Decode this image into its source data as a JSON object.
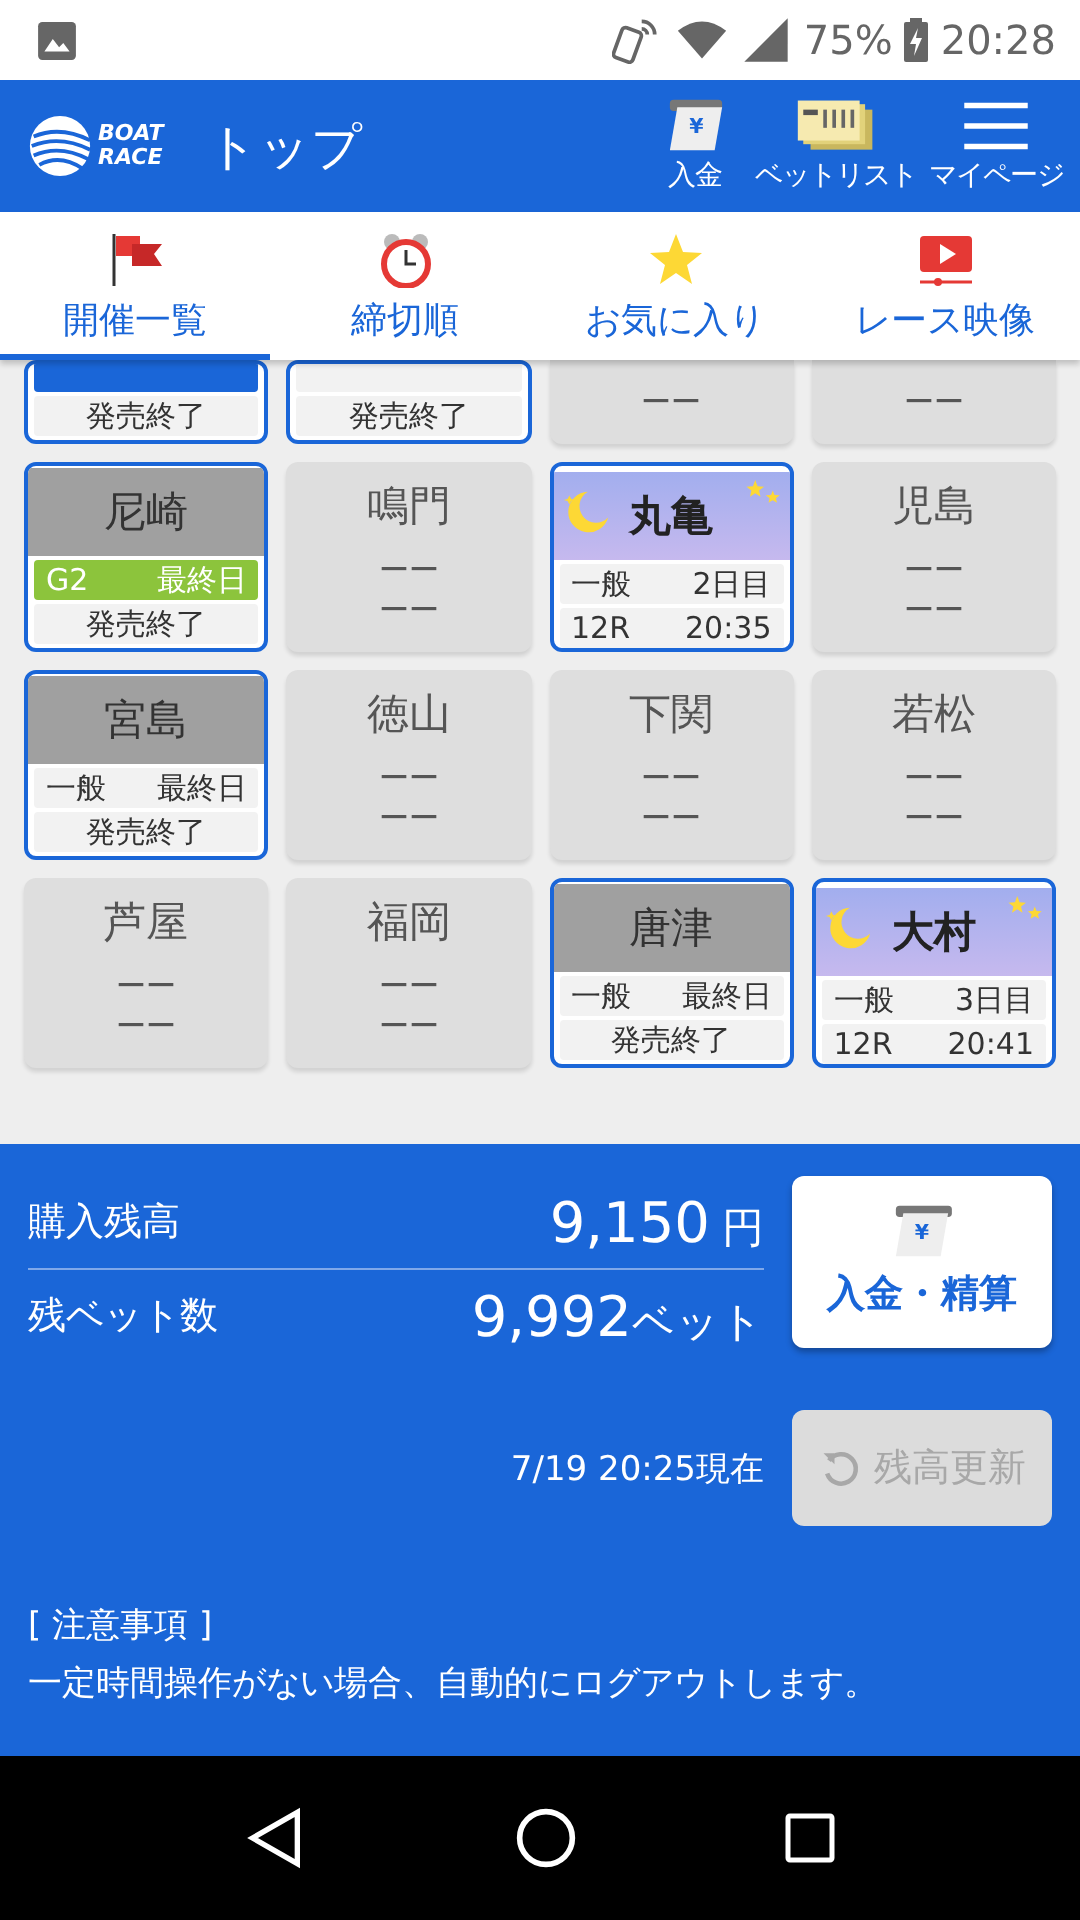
{
  "status_bar": {
    "battery": "75%",
    "time": "20:28"
  },
  "header": {
    "logo": [
      "BOAT",
      "RACE"
    ],
    "title": "トップ",
    "yen_mark": "¥",
    "actions": [
      "入金",
      "ベットリスト",
      "マイページ"
    ]
  },
  "tabs": [
    {
      "label": "開催一覧",
      "selected": true
    },
    {
      "label": "締切順",
      "selected": false
    },
    {
      "label": "お気に入り",
      "selected": false
    },
    {
      "label": "レース映像",
      "selected": false
    }
  ],
  "venues": [
    {
      "kind": "closed",
      "status": "発売終了",
      "color": "#1a66d8"
    },
    {
      "kind": "closed",
      "status": "発売終了"
    },
    {
      "kind": "inactive",
      "line_2": "ーー"
    },
    {
      "kind": "inactive",
      "line_2": "ーー"
    },
    {
      "kind": "closed",
      "name": "尼崎",
      "grade": "G2",
      "day": "最終日",
      "status": "発売終了",
      "color": "#8cc43c"
    },
    {
      "kind": "inactive",
      "name": "鳴門",
      "line_1": "ーー",
      "line_2": "ーー"
    },
    {
      "kind": "night",
      "name": "丸亀",
      "grade": "一般",
      "day": "2日目",
      "race": "12R",
      "time": "20:35"
    },
    {
      "kind": "inactive",
      "name": "児島",
      "line_1": "ーー",
      "line_2": "ーー"
    },
    {
      "kind": "closed",
      "name": "宮島",
      "grade": "一般",
      "day": "最終日",
      "status": "発売終了"
    },
    {
      "kind": "inactive",
      "name": "徳山",
      "line_1": "ーー",
      "line_2": "ーー"
    },
    {
      "kind": "inactive",
      "name": "下関",
      "line_1": "ーー",
      "line_2": "ーー"
    },
    {
      "kind": "inactive",
      "name": "若松",
      "line_1": "ーー",
      "line_2": "ーー"
    },
    {
      "kind": "inactive",
      "name": "芦屋",
      "line_1": "ーー",
      "line_2": "ーー"
    },
    {
      "kind": "inactive",
      "name": "福岡",
      "line_1": "ーー",
      "line_2": "ーー"
    },
    {
      "kind": "closed",
      "name": "唐津",
      "grade": "一般",
      "day": "最終日",
      "status": "発売終了"
    },
    {
      "kind": "night",
      "name": "大村",
      "grade": "一般",
      "day": "3日目",
      "race": "12R",
      "time": "20:41"
    }
  ],
  "balance": {
    "rows": [
      {
        "label": "購入残高",
        "value": "9,150",
        "unit": "円"
      },
      {
        "label": "残ベット数",
        "value": "9,992",
        "unit": "ベット"
      }
    ],
    "deposit_button": "入金・精算",
    "deposit_yen_mark": "¥",
    "timestamp": "7/19 20:25現在",
    "refresh_button": {
      "label": "残高更新",
      "disabled": true
    }
  },
  "notice": {
    "heading": "[ 注意事項 ]",
    "text": "一定時間操作がない場合、自動的にログアウトします。"
  }
}
